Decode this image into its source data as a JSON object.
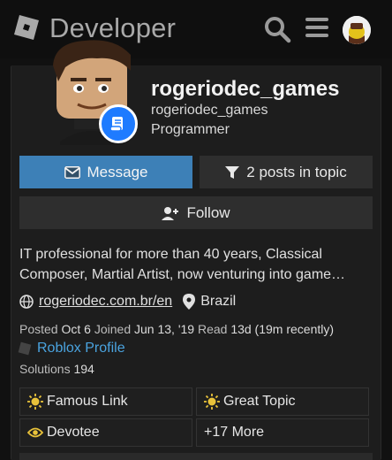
{
  "header": {
    "brand": "Developer",
    "icons": {
      "logo": "roblox-logo-icon",
      "search": "search-icon",
      "menu": "hamburger-menu-icon",
      "avatar": "user-avatar-icon"
    }
  },
  "profile": {
    "username": "rogeriodec_games",
    "realname": "rogeriodec_games",
    "title": "Programmer",
    "badge_icon": "scroll-icon",
    "accent": "#1e7bff"
  },
  "actions": {
    "message_label": "Message",
    "posts_label": "2 posts in topic",
    "follow_label": "Follow",
    "message_color": "#3d80b7"
  },
  "bio": "IT professional for more than 40 years, Classical Composer, Martial Artist, now venturing into game…",
  "location": {
    "website": "rogeriodec.com.br/en",
    "place": "Brazil"
  },
  "stats": {
    "posted_label": "Posted",
    "posted_value": "Oct 6",
    "joined_label": "Joined",
    "joined_value": "Jun 13, '19",
    "read_label": "Read",
    "read_value": "13d (19m recently)",
    "profile_link": "Roblox Profile",
    "solutions_label": "Solutions",
    "solutions_value": "194"
  },
  "badges": [
    {
      "label": "Famous Link",
      "icon": "sun-badge-icon"
    },
    {
      "label": "Great Topic",
      "icon": "sun-badge-icon"
    },
    {
      "label": "Devotee",
      "icon": "eye-badge-icon"
    },
    {
      "label": "+17 More",
      "icon": ""
    }
  ],
  "colors": {
    "badge_gold": "#e8c23a",
    "link": "#4aa3df"
  }
}
